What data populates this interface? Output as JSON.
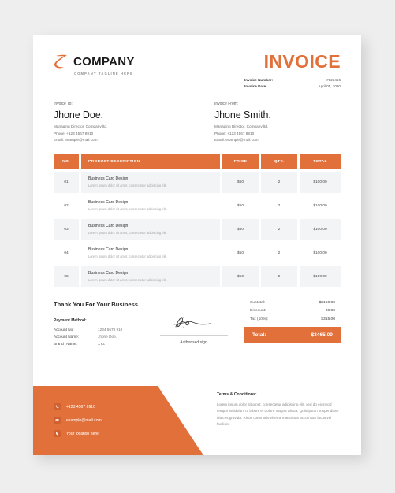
{
  "brand": {
    "logo_icon": "z-mark-logo",
    "name": "COMPANY",
    "tagline": "COMPANY TAGLINE HERE"
  },
  "invoice_header": {
    "title": "INVOICE",
    "meta": [
      {
        "label": "Invoice Number:",
        "value": "#123456"
      },
      {
        "label": "Invoice Date:",
        "value": "April 05, 2020"
      }
    ]
  },
  "bill_to": {
    "label": "Invoice To:",
    "name": "Jhone Doe.",
    "role": "Managing Director, Company ltd.",
    "phone": "Phone: +123 4567 8910",
    "email": "Email: example@mail.com"
  },
  "bill_from": {
    "label": "Invoice From:",
    "name": "Jhone Smith.",
    "role": "Managing Director, Company ltd.",
    "phone": "Phone: +123 4567 8910",
    "email": "Email: example@mail.com"
  },
  "table": {
    "columns": {
      "no": "NO.",
      "description": "PRODUCT DESCRIPTION",
      "price": "PRICE",
      "qty": "QTY.",
      "total": "TOTAL"
    },
    "rows": [
      {
        "no": "01",
        "title": "Business Card Design",
        "sub": "Lorem ipsum dolor sit amet, consectetur adipiscing elit.",
        "price": "$50",
        "qty": "2",
        "total": "$100.00"
      },
      {
        "no": "02",
        "title": "Business Card Design",
        "sub": "Lorem ipsum dolor sit amet, consectetur adipiscing elit.",
        "price": "$50",
        "qty": "2",
        "total": "$100.00"
      },
      {
        "no": "03",
        "title": "Business Card Design",
        "sub": "Lorem ipsum dolor sit amet, consectetur adipiscing elit.",
        "price": "$50",
        "qty": "2",
        "total": "$100.00"
      },
      {
        "no": "04",
        "title": "Business Card Design",
        "sub": "Lorem ipsum dolor sit amet, consectetur adipiscing elit.",
        "price": "$50",
        "qty": "2",
        "total": "$100.00"
      },
      {
        "no": "05",
        "title": "Business Card Design",
        "sub": "Lorem ipsum dolor sit amet, consectetur adipiscing elit.",
        "price": "$50",
        "qty": "2",
        "total": "$100.00"
      }
    ]
  },
  "thanks_note": "Thank You For Your Business",
  "payment": {
    "label": "Payment Method:",
    "rows": [
      {
        "key": "Account No:",
        "value": "1234 5678 910"
      },
      {
        "key": "Account Name:",
        "value": "Jhone Doe."
      },
      {
        "key": "Branch Name:",
        "value": "XYZ"
      }
    ]
  },
  "signature": {
    "icon": "handwritten-signature",
    "label": "Authorised sign"
  },
  "summary": {
    "rows": [
      {
        "label": "Subtotal:",
        "value": "$3150.00"
      },
      {
        "label": "Discount:",
        "value": "00.00"
      },
      {
        "label": "Tax (10%):",
        "value": "$315.00"
      }
    ],
    "total_label": "Total:",
    "total_value": "$3465.00"
  },
  "terms": {
    "title": "Terms & Conditions:",
    "body": "Lorem ipsum dolor sit amet, consectetur adipiscing elit, sed do eiusmod tempor incididunt ut labore et dolore magna aliqua. Quis ipsum suspendisse ultrices gravida. Risus commodo viverra maecenas accumsan lacus vel facilisis."
  },
  "footer_contacts": [
    {
      "icon": "phone-icon",
      "text": "+123 4567 8910"
    },
    {
      "icon": "envelope-icon",
      "text": "example@mail.com"
    },
    {
      "icon": "location-pin-icon",
      "text": "Your location here"
    }
  ],
  "colors": {
    "accent": "#e2703a",
    "accent_dark": "#cf6130",
    "row_alt": "#f2f4f6",
    "page_bg": "#eeeeee"
  }
}
